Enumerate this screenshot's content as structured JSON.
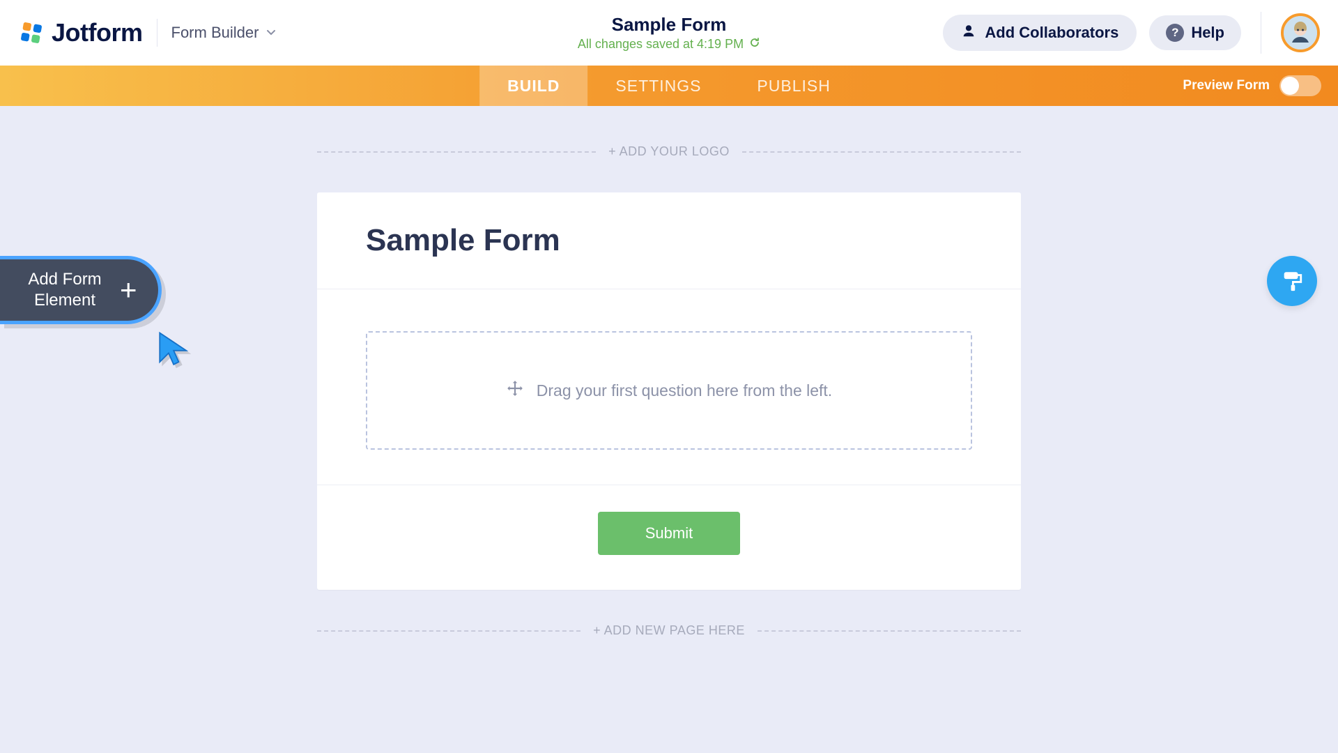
{
  "brand": {
    "name": "Jotform"
  },
  "header": {
    "page_label": "Form Builder",
    "form_title": "Sample Form",
    "save_status": "All changes saved at 4:19 PM",
    "add_collab": "Add Collaborators",
    "help": "Help"
  },
  "nav": {
    "tabs": {
      "build": "BUILD",
      "settings": "SETTINGS",
      "publish": "PUBLISH"
    },
    "preview_label": "Preview Form"
  },
  "sidebar": {
    "add_element_line1": "Add Form",
    "add_element_line2": "Element"
  },
  "canvas": {
    "add_logo": "+ ADD YOUR LOGO",
    "form_title": "Sample Form",
    "dropzone_text": "Drag your first question here from the left.",
    "submit": "Submit",
    "add_page": "+ ADD NEW PAGE HERE"
  }
}
